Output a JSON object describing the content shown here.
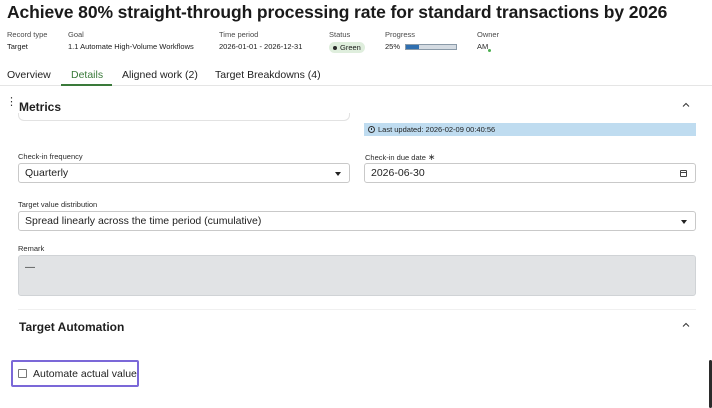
{
  "header": {
    "title": "Achieve 80% straight-through processing rate for standard transactions by 2026"
  },
  "meta": {
    "record_type": {
      "label": "Record type",
      "value": "Target"
    },
    "goal": {
      "label": "Goal",
      "value": "1.1 Automate High-Volume Workflows"
    },
    "time_period": {
      "label": "Time period",
      "value": "2026-01-01 - 2026-12-31"
    },
    "status": {
      "label": "Status",
      "value": "Green",
      "color": "#dfeedd"
    },
    "progress": {
      "label": "Progress",
      "value": "25%",
      "fraction": 0.25,
      "color": "#2f6fb0"
    },
    "owner": {
      "label": "Owner",
      "value": "AM"
    }
  },
  "tabs": [
    {
      "label": "Overview",
      "active": false
    },
    {
      "label": "Details",
      "active": true
    },
    {
      "label": "Aligned work (2)",
      "active": false
    },
    {
      "label": "Target Breakdowns (4)",
      "active": false
    }
  ],
  "metrics": {
    "title": "Metrics",
    "last_updated": "Last updated: 2026-02-09 00:40:56",
    "checkin_frequency": {
      "label": "Check-in frequency",
      "value": "Quarterly"
    },
    "checkin_due_date": {
      "label": "Check-in due date",
      "required_mark": "∗",
      "value": "2026-06-30"
    },
    "target_value_distribution": {
      "label": "Target value distribution",
      "value": "Spread linearly across the time period (cumulative)"
    },
    "remark": {
      "label": "Remark",
      "value": "—"
    }
  },
  "target_automation": {
    "title": "Target Automation",
    "automate_actual_value": {
      "label": "Automate actual value",
      "checked": false
    }
  },
  "colors": {
    "accent_green": "#3a7a3a",
    "focus_outline": "#7b68d8",
    "info_bar": "#bfdcf0"
  }
}
